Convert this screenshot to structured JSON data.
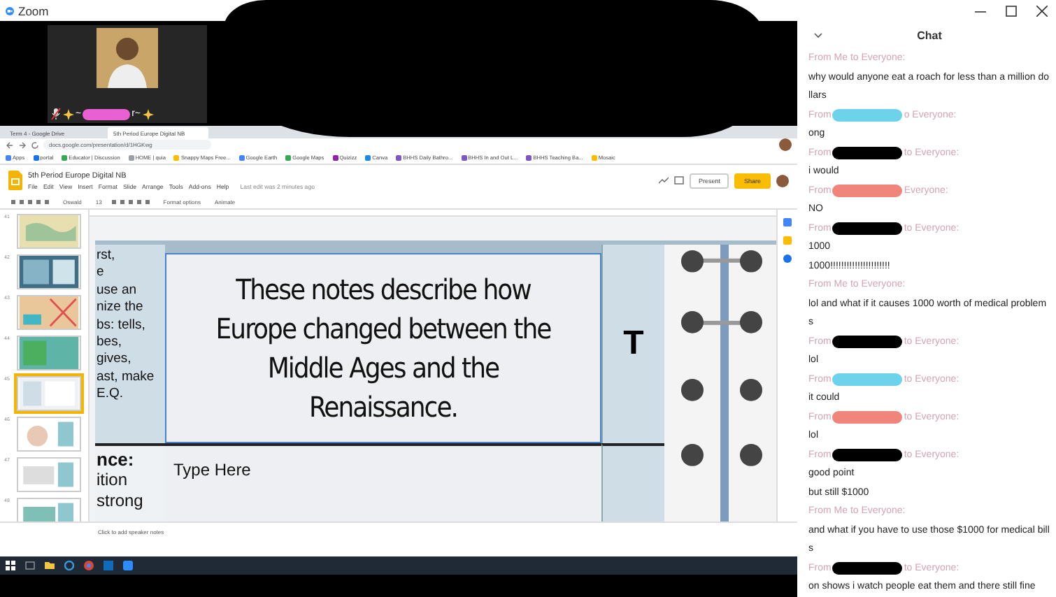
{
  "window": {
    "title": "Zoom"
  },
  "video_tile": {
    "name_prefix": "~",
    "name_suffix": "r~",
    "muted": true,
    "color": "#e860d2"
  },
  "browser": {
    "tabs": [
      {
        "label": "Term 4 - Google Drive",
        "selected": false
      },
      {
        "label": "5th Period Europe Digital NB",
        "selected": true
      }
    ],
    "url": "docs.google.com/presentation/d/1HGKwg",
    "bookmarks": [
      "Apps",
      "portal",
      "Educator | Discussion",
      "HOME | quia",
      "Snappy Maps Free...",
      "Google Earth",
      "Google Maps",
      "Quizizz",
      "Canva",
      "BHHS Daily Bathro...",
      "BHHS In and Out L...",
      "BHHS Teaching Ba...",
      "Mosaic"
    ]
  },
  "slides": {
    "title": "5th Period Europe Digital NB",
    "menus": [
      "File",
      "Edit",
      "View",
      "Insert",
      "Format",
      "Slide",
      "Arrange",
      "Tools",
      "Add-ons",
      "Help"
    ],
    "last_edit": "Last edit was 2 minutes ago",
    "font": "Oswald",
    "font_size": "13",
    "format_options": "Format options",
    "animate": "Animate",
    "present": "Present",
    "share": "Share",
    "thumbnails": [
      {
        "number": "41",
        "selected": false
      },
      {
        "number": "42",
        "selected": false
      },
      {
        "number": "43",
        "selected": false
      },
      {
        "number": "44",
        "selected": false
      },
      {
        "number": "45",
        "selected": true
      },
      {
        "number": "46",
        "selected": false
      },
      {
        "number": "47",
        "selected": false
      },
      {
        "number": "48",
        "selected": false
      }
    ],
    "slide": {
      "left_fragments": [
        "rst,",
        "e",
        "use an",
        "nize the",
        "bs:  tells,",
        "bes,",
        "gives,",
        "ast, make",
        "E.Q."
      ],
      "left_lower_fragments": [
        "nce:",
        "ition",
        "strong"
      ],
      "title": "These notes describe how Europe changed between the Middle Ages and the Renaissance.",
      "body_placeholder": "Type Here",
      "side_letter": "T"
    },
    "speaker_notes_placeholder": "Click to add speaker notes"
  },
  "chat": {
    "title": "Chat",
    "messages": [
      {
        "kind": "self",
        "header": "From Me to Everyone:",
        "lines": [
          "why would anyone eat a roach for less than a million dollars"
        ]
      },
      {
        "kind": "redacted",
        "prefix": "From",
        "suffix": "o Everyone:",
        "color": "#6dd3ea",
        "lines": [
          "ong"
        ]
      },
      {
        "kind": "redacted",
        "prefix": "From",
        "suffix": "to Everyone:",
        "color": "#000000",
        "lines": [
          "i would"
        ]
      },
      {
        "kind": "redacted",
        "prefix": "From",
        "suffix": "Everyone:",
        "color": "#f0857c",
        "lines": [
          "NO"
        ]
      },
      {
        "kind": "redacted",
        "prefix": "From",
        "suffix": "to Everyone:",
        "color": "#000000",
        "lines": [
          "1000",
          "1000!!!!!!!!!!!!!!!!!!!!!!"
        ]
      },
      {
        "kind": "self",
        "header": "From Me to Everyone:",
        "lines": [
          "lol and what if it causes 1000 worth of medical problems"
        ]
      },
      {
        "kind": "redacted",
        "prefix": "From",
        "suffix": "to Everyone:",
        "color": "#000000",
        "lines": [
          "lol"
        ]
      },
      {
        "kind": "redacted",
        "prefix": "From",
        "suffix": "to Everyone:",
        "color": "#6dd3ea",
        "lines": [
          "it could"
        ]
      },
      {
        "kind": "redacted",
        "prefix": "From",
        "suffix": "to Everyone:",
        "color": "#f0857c",
        "lines": [
          "lol"
        ]
      },
      {
        "kind": "redacted",
        "prefix": "From",
        "suffix": "to Everyone:",
        "color": "#000000",
        "lines": [
          "good point",
          "but still $1000"
        ]
      },
      {
        "kind": "self",
        "header": "From Me to Everyone:",
        "lines": [
          "and what if you have to use those $1000 for medical bills"
        ]
      },
      {
        "kind": "redacted",
        "prefix": "From",
        "suffix": "to Everyone:",
        "color": "#000000",
        "lines": [
          "on shows i watch people eat them and there still fine"
        ]
      }
    ]
  }
}
